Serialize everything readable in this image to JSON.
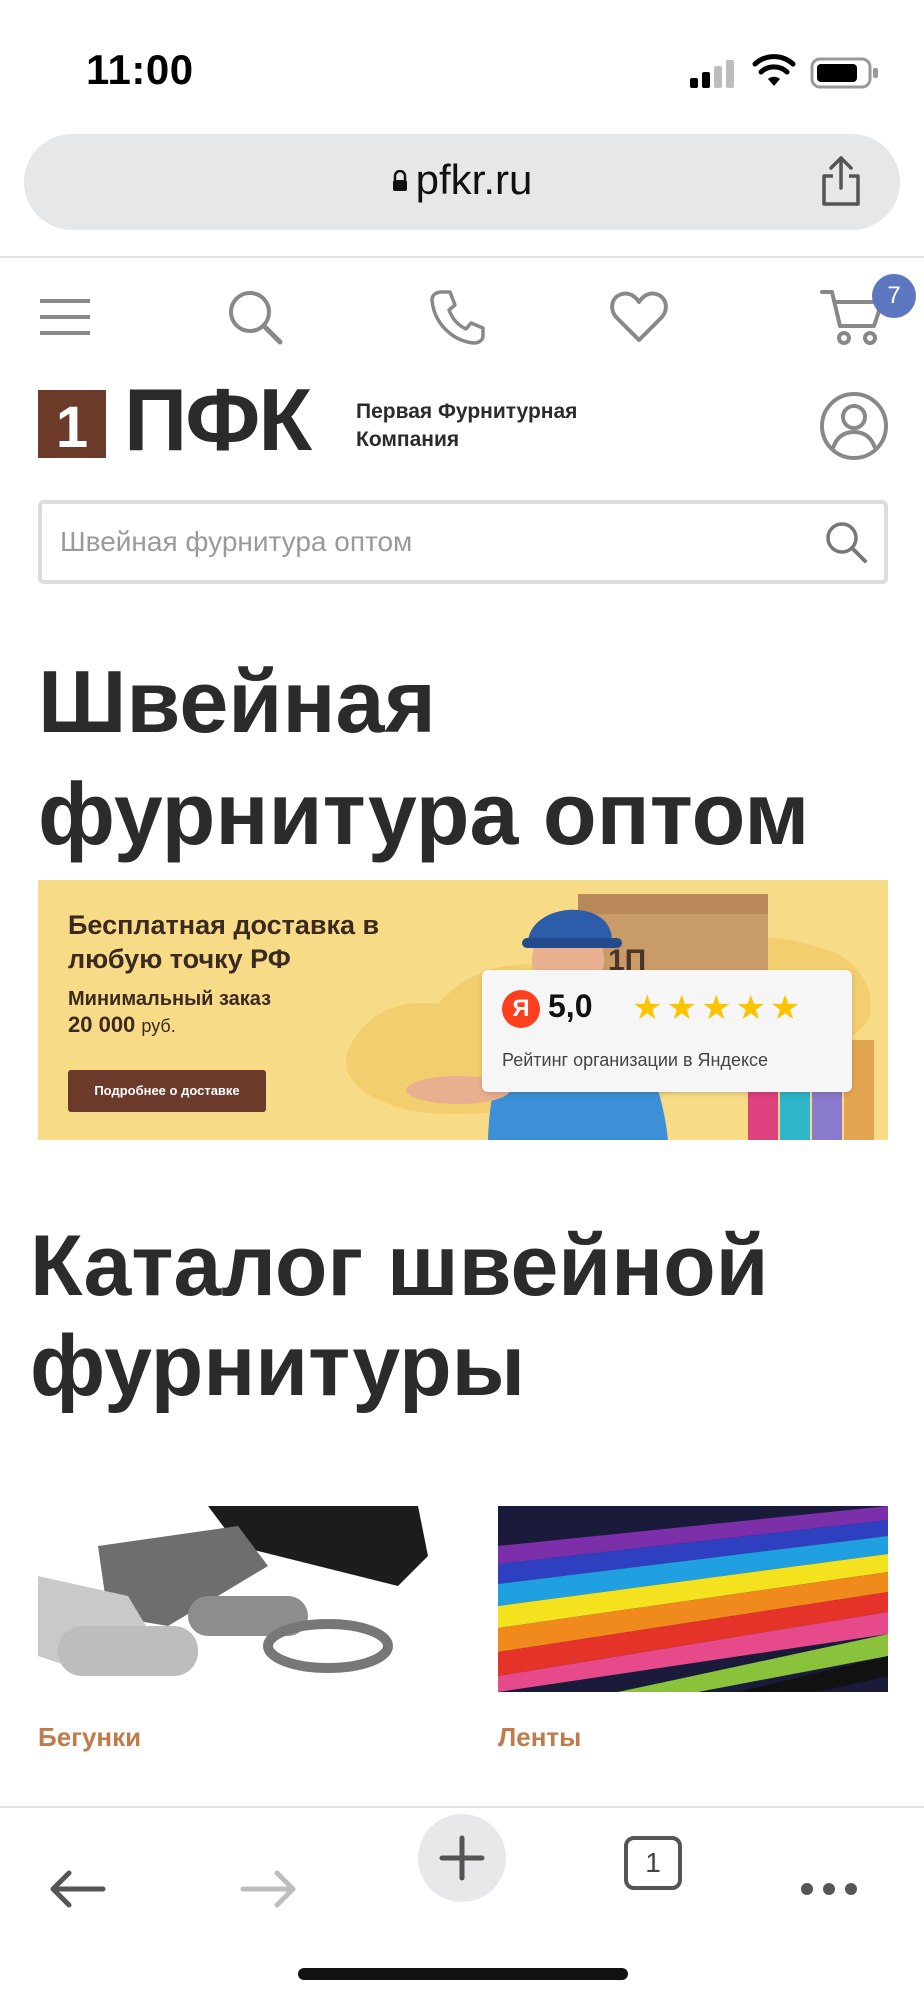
{
  "status_bar": {
    "time": "11:00"
  },
  "browser": {
    "url": "pfkr.ru",
    "tabs_count": "1"
  },
  "site_nav": {
    "cart_count": "7"
  },
  "logo": {
    "box_text": "1",
    "word": "ПФК",
    "tagline": "Первая Фурнитурная Компания"
  },
  "search": {
    "placeholder": "Швейная фурнитура оптом"
  },
  "hero": {
    "title": "Швейная фурнитура оптом"
  },
  "banner": {
    "title": "Бесплатная доставка в любую точку РФ",
    "min_order_label": "Минимальный заказ",
    "min_order_amount": "20 000",
    "currency": "руб.",
    "button_label": "Подробнее о доставке",
    "rating": {
      "badge": "Я",
      "value": "5,0",
      "stars": "★★★★★",
      "caption": "Рейтинг организации в Яндексе"
    }
  },
  "catalog": {
    "title": "Каталог швейной фурнитуры",
    "items": [
      {
        "label": "Бегунки"
      },
      {
        "label": "Ленты"
      }
    ]
  },
  "colors": {
    "accent_brown": "#6d3b2a",
    "label_orange": "#c07b4a",
    "banner_yellow": "#f8db86",
    "badge_blue": "#5c77bf",
    "star_yellow": "#fcc400"
  }
}
